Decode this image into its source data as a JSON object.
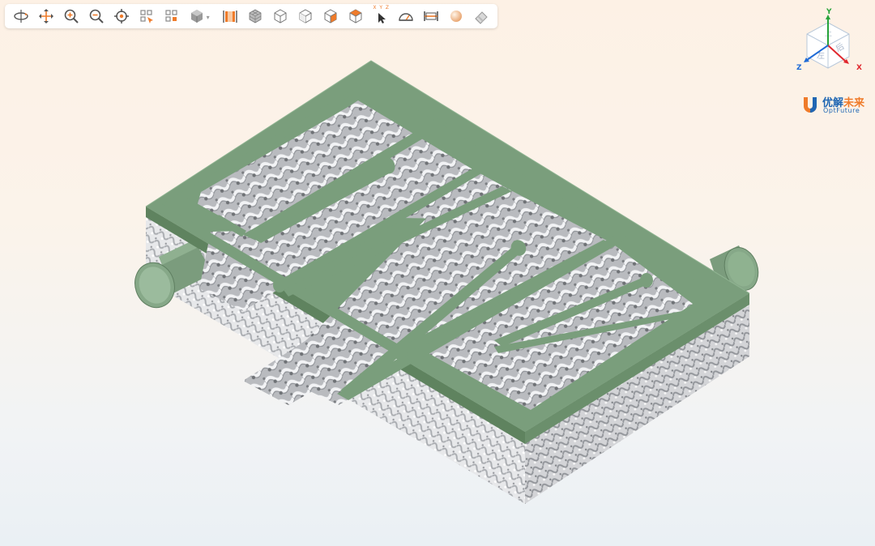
{
  "toolbar": {
    "buttons": [
      {
        "name": "rotate",
        "icon": "rotate-icon"
      },
      {
        "name": "pan",
        "icon": "pan-icon"
      },
      {
        "name": "zoom-in",
        "icon": "zoom-in-icon"
      },
      {
        "name": "zoom-out",
        "icon": "zoom-out-icon"
      },
      {
        "name": "focus",
        "icon": "target-icon"
      },
      {
        "name": "zoom-window",
        "icon": "zoom-window-icon"
      },
      {
        "name": "zoom-fit",
        "icon": "zoom-fit-icon"
      },
      {
        "name": "view-mode",
        "icon": "cube-dropdown-icon"
      },
      {
        "name": "section",
        "icon": "section-plane-icon"
      },
      {
        "name": "view-iso",
        "icon": "mesh-cube-icon"
      },
      {
        "name": "view-front",
        "icon": "cube-front-icon"
      },
      {
        "name": "view-back",
        "icon": "cube-back-icon"
      },
      {
        "name": "view-right",
        "icon": "cube-right-icon"
      },
      {
        "name": "view-top",
        "icon": "cube-top-icon"
      },
      {
        "name": "pick-point",
        "icon": "xyz-pointer-icon"
      },
      {
        "name": "measure-angle",
        "icon": "protractor-icon"
      },
      {
        "name": "measure-distance",
        "icon": "ruler-icon"
      },
      {
        "name": "material",
        "icon": "sphere-icon"
      },
      {
        "name": "eraser",
        "icon": "eraser-icon"
      }
    ],
    "pick_label": "X Y Z"
  },
  "viewcube": {
    "axes": {
      "x": "X",
      "y": "Y",
      "z": "Z"
    },
    "colors": {
      "x": "#e0282e",
      "y": "#27a339",
      "z": "#1f6bd6"
    }
  },
  "logo": {
    "cn_main": "优解",
    "cn_accent": "未来",
    "en": "OptFuture",
    "colors": {
      "blue": "#1f66b3",
      "orange": "#ef7b2a"
    }
  },
  "model": {
    "frame_color": "#7a9e7c",
    "lattice_color": "#c9cacd"
  }
}
